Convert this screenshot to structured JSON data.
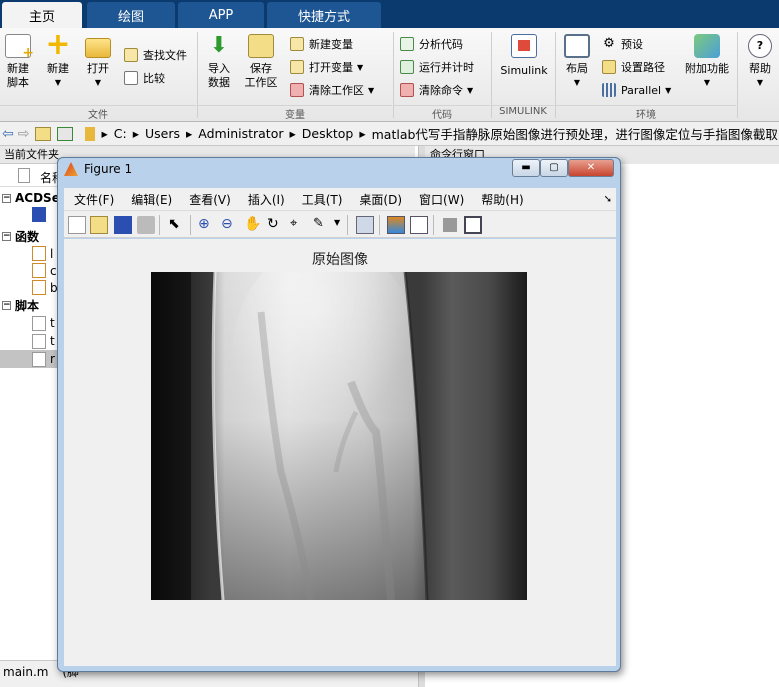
{
  "tabs": [
    {
      "label": "主页",
      "active": true
    },
    {
      "label": "绘图",
      "active": false
    },
    {
      "label": "APP",
      "active": false
    },
    {
      "label": "快捷方式",
      "active": false
    }
  ],
  "ribbon": {
    "file": {
      "label": "文件",
      "new_script": [
        "新建",
        "脚本"
      ],
      "new": "新建",
      "open": "打开",
      "find_files": "查找文件",
      "compare": "比较"
    },
    "variable": {
      "label": "变量",
      "import": [
        "导入",
        "数据"
      ],
      "save_ws": [
        "保存",
        "工作区"
      ],
      "new_var": "新建变量",
      "open_var": "打开变量",
      "clear_ws": "清除工作区"
    },
    "code": {
      "label": "代码",
      "analyze": "分析代码",
      "run_time": "运行并计时",
      "clear_cmd": "清除命令"
    },
    "simulink": {
      "label": "SIMULINK",
      "button": "Simulink"
    },
    "env": {
      "label": "环境",
      "layout": "布局",
      "prefs": "预设",
      "set_path": "设置路径",
      "parallel": "Parallel",
      "addons": "附加功能"
    },
    "resources": {
      "help": "帮助"
    }
  },
  "address": {
    "crumbs": [
      "C:",
      "Users",
      "Administrator",
      "Desktop",
      "matlab代写手指静脉原始图像进行预处理，进行图像定位与手指图像截取"
    ]
  },
  "left_panel": {
    "header": "当前文件夹",
    "col_name": "名称",
    "groups": [
      {
        "title": "ACDSe",
        "items": [
          ""
        ]
      },
      {
        "title": "函数",
        "items": [
          "l",
          "c",
          "b"
        ]
      },
      {
        "title": "脚本",
        "items": [
          "t",
          "t",
          "r"
        ]
      }
    ]
  },
  "command_window": {
    "header": "命令行窗口"
  },
  "status_bar": {
    "file": "main.m",
    "extra": "(脚"
  },
  "figure": {
    "title": "Figure 1",
    "menu": [
      "文件(F)",
      "编辑(E)",
      "查看(V)",
      "插入(I)",
      "工具(T)",
      "桌面(D)",
      "窗口(W)",
      "帮助(H)"
    ],
    "axes_title": "原始图像",
    "window_buttons": {
      "minimize": "▬",
      "maximize": "▢",
      "close": "✕"
    }
  }
}
